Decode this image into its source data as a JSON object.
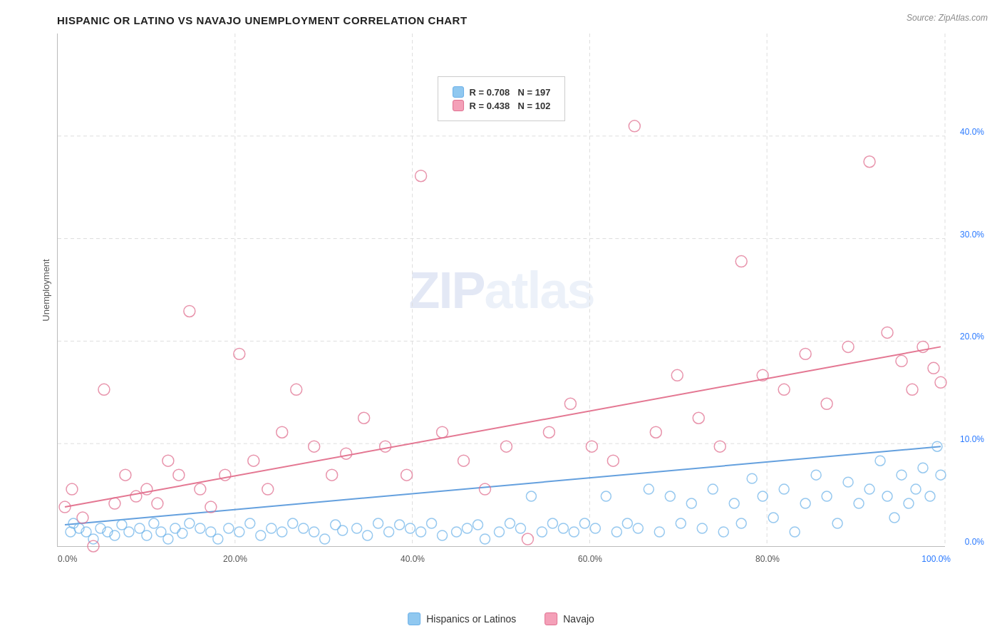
{
  "title": "HISPANIC OR LATINO VS NAVAJO UNEMPLOYMENT CORRELATION CHART",
  "source": "Source: ZipAtlas.com",
  "yAxisLabel": "Unemployment",
  "legend": {
    "blue": {
      "r": "R = 0.708",
      "n": "N = 197",
      "color": "#90c8f0",
      "border": "#6ab0e8"
    },
    "pink": {
      "r": "R = 0.438",
      "n": "N = 102",
      "color": "#f4a0b8",
      "border": "#e07090"
    }
  },
  "xTicks": [
    "0.0%",
    "20.0%",
    "40.0%",
    "60.0%",
    "80.0%",
    "100.0%"
  ],
  "yTicks": [
    "0.0%",
    "10.0%",
    "20.0%",
    "30.0%",
    "40.0%"
  ],
  "watermark": {
    "zip": "ZIP",
    "atlas": "atlas"
  },
  "xLegend": [
    {
      "label": "Hispanics or Latinos",
      "color": "#90c8f0",
      "border": "#6ab0e8"
    },
    {
      "label": "Navajo",
      "color": "#f4a0b8",
      "border": "#e07090"
    }
  ]
}
